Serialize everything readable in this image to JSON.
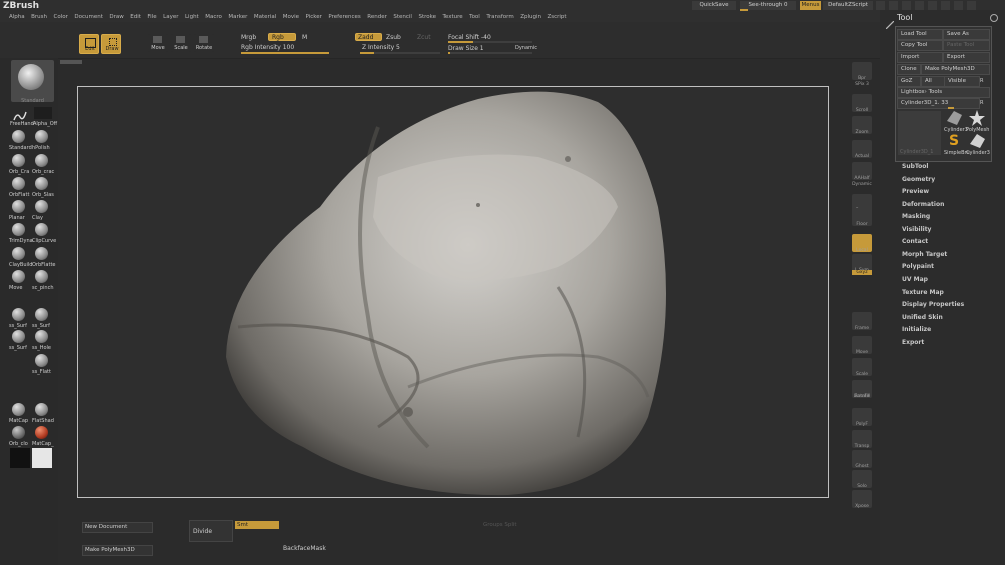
{
  "app": {
    "name": "ZBrush"
  },
  "menus": [
    "Alpha",
    "Brush",
    "Color",
    "Document",
    "Draw",
    "Edit",
    "File",
    "Layer",
    "Light",
    "Macro",
    "Marker",
    "Material",
    "Movie",
    "Picker",
    "Preferences",
    "Render",
    "Stencil",
    "Stroke",
    "Texture",
    "Tool",
    "Transform",
    "Zplugin",
    "Zscript"
  ],
  "topright": {
    "quicksave": "QuickSave",
    "seethrough": "See-through  0",
    "menus": "Menus",
    "script": "DefaultZScript"
  },
  "shelf": {
    "edit": "Edit",
    "draw": "Draw",
    "move": "Move",
    "scale": "Scale",
    "rotate": "Rotate",
    "mrgb": "Mrgb",
    "rgb": "Rgb",
    "m": "M",
    "rgb_intensity": "Rgb Intensity 100",
    "rgb_intensity_value": 1.0,
    "zadd": "Zadd",
    "zsub": "Zsub",
    "zcut": "Zcut",
    "z_intensity": "Z Intensity 5",
    "z_intensity_value": 0.05,
    "focal_shift": "Focal Shift -40",
    "focal_shift_value": 0.3,
    "draw_size": "Draw Size 1",
    "draw_size_value": 0.01,
    "dynamic": "Dynamic"
  },
  "left_tray": {
    "brush_icon_label": "Standard",
    "freehand": "FreeHand",
    "alpha_off": "Alpha_Off",
    "brushes": [
      [
        "Standard",
        "hPolish"
      ],
      [
        "Orb_Cra",
        "Orb_crac"
      ],
      [
        "OrbFlatt",
        "Orb_Slas"
      ],
      [
        "Planar",
        "Clay"
      ],
      [
        "TrimDyna",
        "ClipCurve"
      ],
      [
        "ClayBuild",
        "OrbFlatte"
      ],
      [
        "Move",
        "sc_pinch"
      ],
      [
        "ss_Surf",
        "ss_Surf"
      ],
      [
        "ss_Surf",
        "ss_Hole"
      ],
      [
        "",
        "ss_Flatt"
      ]
    ],
    "materials": [
      "MatCap",
      "FlatShad",
      "Orb_clo",
      "MatCap_"
    ]
  },
  "right_shelf": [
    "Bpr",
    "SPix 3",
    "Scroll",
    "Zoom",
    "Actual",
    "AAHalf",
    "Dynamic",
    "Persp",
    "Floor",
    "Local",
    "L.Sym",
    "Gxyz",
    "Frame",
    "Move",
    "Scale",
    "Rotate",
    "Line Fill",
    "PolyF",
    "Transp",
    "Ghost",
    "Solo",
    "Xpose"
  ],
  "tool_panel": {
    "title": "Tool",
    "load": "Load Tool",
    "save": "Save As",
    "copy": "Copy Tool",
    "paste": "Paste Tool",
    "import": "Import",
    "export": "Export",
    "clone": "Clone",
    "make_poly": "Make PolyMesh3D",
    "goz": "GoZ",
    "all": "All",
    "visible": "Visible",
    "r": "R",
    "lightbox": "Lightbox› Tools",
    "current_tool": "Cylinder3D_1. 33",
    "r2": "R",
    "thumbs": [
      "Cylinder3",
      "PolyMesh",
      "SimpleBru",
      "Cylinder3"
    ],
    "tool_preview_label": "Cylinder3D_1",
    "sections": [
      "SubTool",
      "Geometry",
      "Preview",
      "Deformation",
      "Masking",
      "Visibility",
      "Contact",
      "Morph Target",
      "Polypaint",
      "UV Map",
      "Texture Map",
      "Display Properties",
      "Unified Skin",
      "Initialize",
      "Export"
    ]
  },
  "bottom": {
    "new_doc": "New Document",
    "make_poly": "Make PolyMesh3D",
    "divide": "Divide",
    "smt": "Smt",
    "backface": "BackfaceMask",
    "faded": "Groups Split"
  },
  "colors": {
    "accent": "#c69a3a",
    "background": "#2b2b2b",
    "panel": "#2c2c2c"
  }
}
